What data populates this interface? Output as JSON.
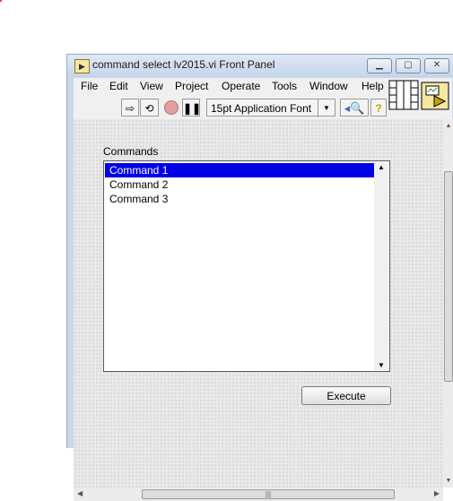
{
  "window": {
    "title": "command select lv2015.vi Front Panel"
  },
  "menu": [
    "File",
    "Edit",
    "View",
    "Project",
    "Operate",
    "Tools",
    "Window",
    "Help"
  ],
  "toolbar": {
    "font_select": "15pt Application Font"
  },
  "panel": {
    "listbox_label": "Commands",
    "items": [
      "Command 1",
      "Command 2",
      "Command 3"
    ],
    "selected_index": 0,
    "execute_label": "Execute"
  },
  "icons": [
    "run-arrow-icon",
    "run-continuous-icon",
    "abort-icon",
    "pause-icon",
    "align-icon",
    "search-icon",
    "help-icon",
    "connector-pane-icon",
    "vi-icon"
  ],
  "colors": {
    "selection": "#0000e6",
    "panel_grid": "#e8e8e8",
    "title_bar": "#c9d7e9"
  }
}
